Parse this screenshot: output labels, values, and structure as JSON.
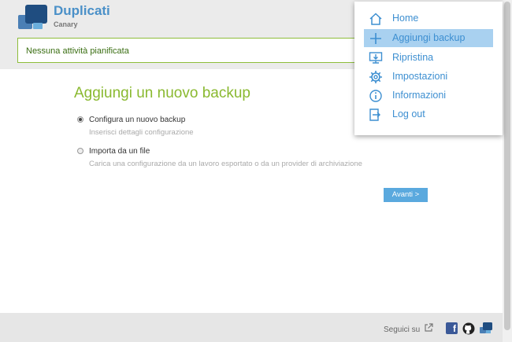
{
  "app": {
    "name": "Duplicati",
    "channel": "Canary"
  },
  "status": {
    "text": "Nessuna attività pianificata"
  },
  "page": {
    "title": "Aggiungi un nuovo backup",
    "options": [
      {
        "label": "Configura un nuovo backup",
        "desc": "Inserisci dettagli configurazione",
        "selected": true
      },
      {
        "label": "Importa da un file",
        "desc": "Carica una configurazione da un lavoro esportato o da un provider di archiviazione",
        "selected": false
      }
    ],
    "next_label": "Avanti >"
  },
  "menu": {
    "items": [
      {
        "label": "Home",
        "icon": "home-icon"
      },
      {
        "label": "Aggiungi backup",
        "icon": "plus-icon",
        "active": true
      },
      {
        "label": "Ripristina",
        "icon": "restore-icon"
      },
      {
        "label": "Impostazioni",
        "icon": "gear-icon"
      },
      {
        "label": "Informazioni",
        "icon": "info-icon"
      },
      {
        "label": "Log out",
        "icon": "logout-icon"
      }
    ]
  },
  "footer": {
    "follow_label": "Seguici su"
  },
  "colors": {
    "accent": "#8ab930",
    "brand": "#4a90c8",
    "link": "#3d8fd1",
    "menu_active": "#a9d1f0",
    "button": "#5aa9de"
  }
}
